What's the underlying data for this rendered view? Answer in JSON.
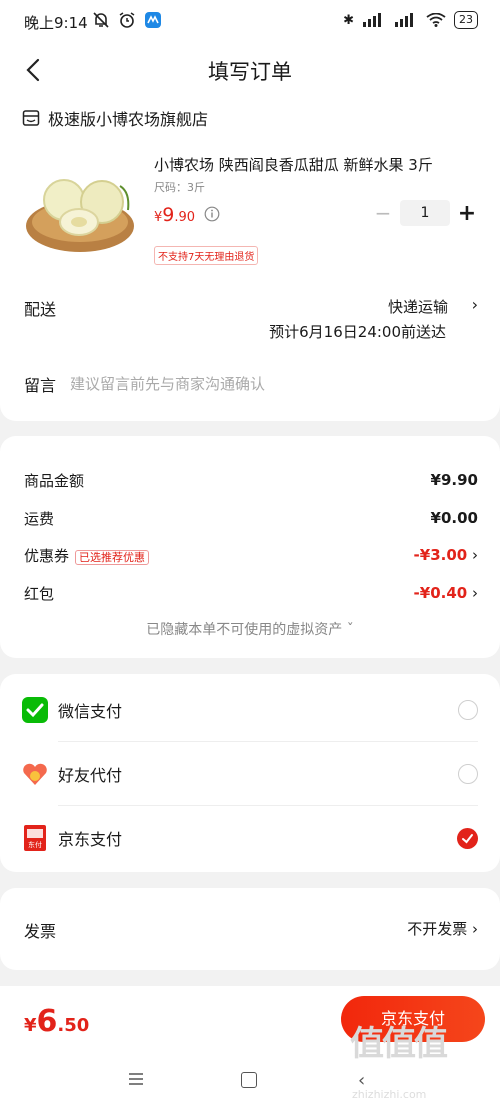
{
  "status_bar": {
    "time": "晚上9:14",
    "battery": "23"
  },
  "header": {
    "title": "填写订单"
  },
  "shop": {
    "name": "极速版小博农场旗舰店"
  },
  "product": {
    "title": "小博农场 陕西阎良香瓜甜瓜 新鲜水果 3斤",
    "size": "尺码：3斤",
    "price_symbol": "¥",
    "price_int": "9",
    "price_dec": ".90",
    "no_return_tag": "不支持7天无理由退货",
    "quantity": "1",
    "minus": "−",
    "plus": "+"
  },
  "delivery": {
    "label": "配送",
    "method": "快递运输",
    "eta": "预计6月16日24:00前送达",
    "arrow": "›"
  },
  "remark": {
    "label": "留言",
    "placeholder": "建议留言前先与商家沟通确认"
  },
  "price_summary": {
    "goods_label": "商品金额",
    "goods_value": "¥9.90",
    "shipping_label": "运费",
    "shipping_value": "¥0.00",
    "coupon_label": "优惠券",
    "coupon_tag": "已选推荐优惠",
    "coupon_value": "-¥3.00",
    "redpacket_label": "红包",
    "redpacket_value": "-¥0.40",
    "hidden_assets": "已隐藏本单不可使用的虚拟资产 ˇ",
    "arrow": "›"
  },
  "payment": {
    "options": [
      {
        "label": "微信支付",
        "selected": false
      },
      {
        "label": "好友代付",
        "selected": false
      },
      {
        "label": "京东支付",
        "selected": true
      }
    ],
    "jd_icon_text": "东付"
  },
  "invoice": {
    "label": "发票",
    "value": "不开发票 ›"
  },
  "bottom": {
    "total_symbol": "¥",
    "total_int": "6",
    "total_dec": ".50",
    "pay_button": "京东支付"
  },
  "watermark": {
    "text": "值值值",
    "sub": "zhizhizhi.com"
  },
  "colors": {
    "accent": "#e2231a",
    "wechat": "#09bb07"
  }
}
